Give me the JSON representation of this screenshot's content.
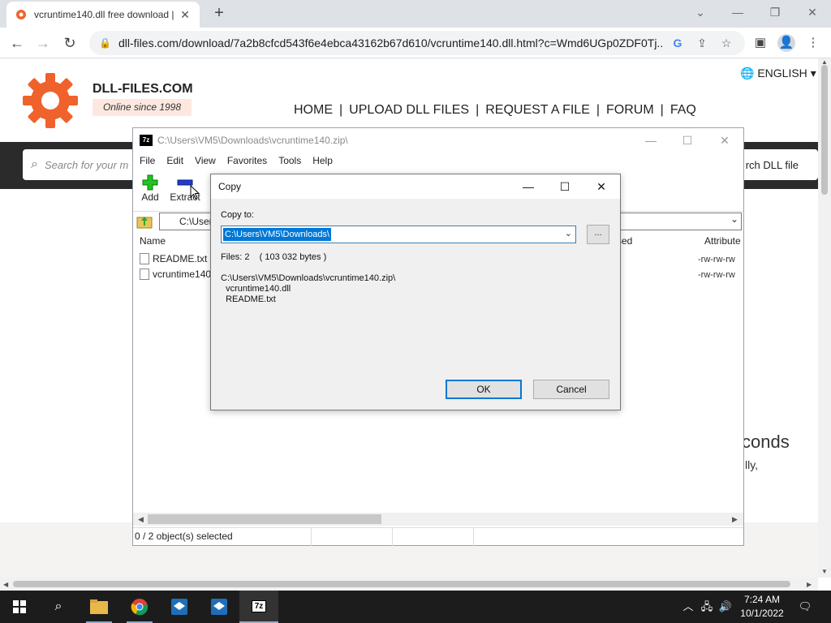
{
  "browser": {
    "tab_title": "vcruntime140.dll free download |",
    "url": "dll-files.com/download/7a2b8cfcd543f6e4ebca43162b67d610/vcruntime140.dll.html?c=Wmd6UGp0ZDF0Tj..."
  },
  "site": {
    "name": "DLL-FILES.COM",
    "tagline": "Online since 1998",
    "language": "ENGLISH",
    "nav": [
      "HOME",
      "UPLOAD DLL FILES",
      "REQUEST A FILE",
      "FORUM",
      "FAQ"
    ],
    "nav_sep": "|",
    "search_placeholder": "Search for your m",
    "search_button": "rch DLL file",
    "bg_text_1": "conds",
    "bg_text_2": "lly,"
  },
  "sevenzip": {
    "title": "C:\\Users\\VM5\\Downloads\\vcruntime140.zip\\",
    "app_icon": "7z",
    "menu": [
      "File",
      "Edit",
      "View",
      "Favorites",
      "Tools",
      "Help"
    ],
    "tools": {
      "add": "Add",
      "extract": "Extract"
    },
    "address": "C:\\User",
    "columns": {
      "name": "Name",
      "sed": "sed",
      "attributes": "Attribute"
    },
    "files": [
      {
        "name": "README.txt",
        "attr": "-rw-rw-rw"
      },
      {
        "name": "vcruntime140",
        "attr": "-rw-rw-rw"
      }
    ],
    "status": "0 / 2 object(s) selected"
  },
  "dialog": {
    "title": "Copy",
    "copy_to_label": "Copy to:",
    "copy_to_value": "C:\\Users\\VM5\\Downloads\\",
    "browse": "...",
    "files_label": "Files: 2    ( 103 032 bytes )",
    "path_lines": [
      "C:\\Users\\VM5\\Downloads\\vcruntime140.zip\\",
      "  vcruntime140.dll",
      "  README.txt"
    ],
    "ok": "OK",
    "cancel": "Cancel"
  },
  "taskbar": {
    "time": "7:24 AM",
    "date": "10/1/2022"
  },
  "colors": {
    "accent": "#0078d7",
    "logo_orange": "#f0622b"
  }
}
